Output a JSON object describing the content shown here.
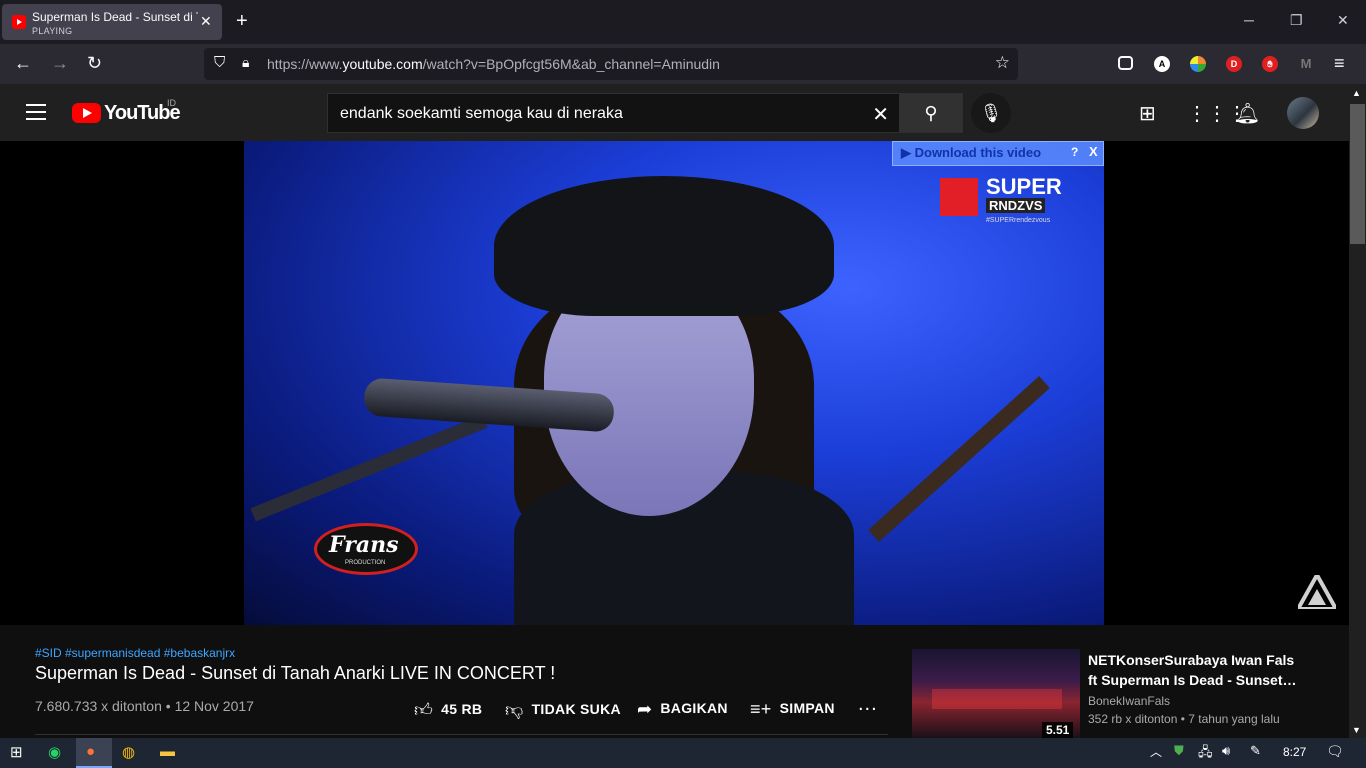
{
  "browser": {
    "tab_title": "Superman Is Dead - Sunset di Tanah Anarki LIVE IN CONCERT !",
    "tab_status": "PLAYING",
    "new_tab": "+",
    "url_prefix": "https://www.",
    "url_host": "youtube.com",
    "url_path": "/watch?v=BpOpfcgt56M&ab_channel=Aminudin",
    "window_min": "─",
    "window_restore": "❐",
    "window_close": "✕"
  },
  "extensions": [
    {
      "name": "pocket-icon",
      "label": "",
      "color": "#2b2a33"
    },
    {
      "name": "account-icon",
      "label": "A",
      "color": "#ffffff"
    },
    {
      "name": "colorful-extension-icon",
      "label": "",
      "color": "#3a9a3a"
    },
    {
      "name": "d-extension-icon",
      "label": "D",
      "color": "#e02020"
    },
    {
      "name": "adblock-hand-icon",
      "label": "",
      "color": "#e02020"
    },
    {
      "name": "m-extension-icon",
      "label": "",
      "color": "#555555"
    }
  ],
  "youtube": {
    "logo_text": "YouTube",
    "country_code": "ID",
    "search_value": "endank soekamti semoga kau di neraka"
  },
  "player": {
    "download_label": "Download this video",
    "download_help": "?",
    "download_close": "X",
    "channel_logo_top": "SUPER",
    "channel_logo_bottom": "RNDZVS",
    "channel_logo_tag": "#SUPERrendezvous",
    "production_logo": "Frans",
    "production_logo_sub": "PRODUCTION"
  },
  "video": {
    "hashtags": "#SID #supermanisdead #bebaskanjrx",
    "title": "Superman Is Dead - Sunset di Tanah Anarki LIVE IN CONCERT !",
    "views_date": "7.680.733 x ditonton • 12 Nov 2017",
    "like_label": "45 RB",
    "dislike_label": "TIDAK SUKA",
    "share_label": "BAGIKAN",
    "save_label": "SIMPAN",
    "more_label": "..."
  },
  "suggestion": {
    "title_line1": "NETKonserSurabaya Iwan Fals",
    "title_line2": "ft Superman Is Dead - Sunset ...",
    "channel": "BonekIwanFals",
    "meta": "352 rb x ditonton • 7 tahun yang lalu",
    "duration": "5.51"
  },
  "taskbar": {
    "clock": "8:27"
  },
  "colors": {
    "youtube_red": "#ff0000",
    "link_blue": "#3ea6ff",
    "page_bg": "#0f0f0f",
    "header_bg": "#202020"
  }
}
